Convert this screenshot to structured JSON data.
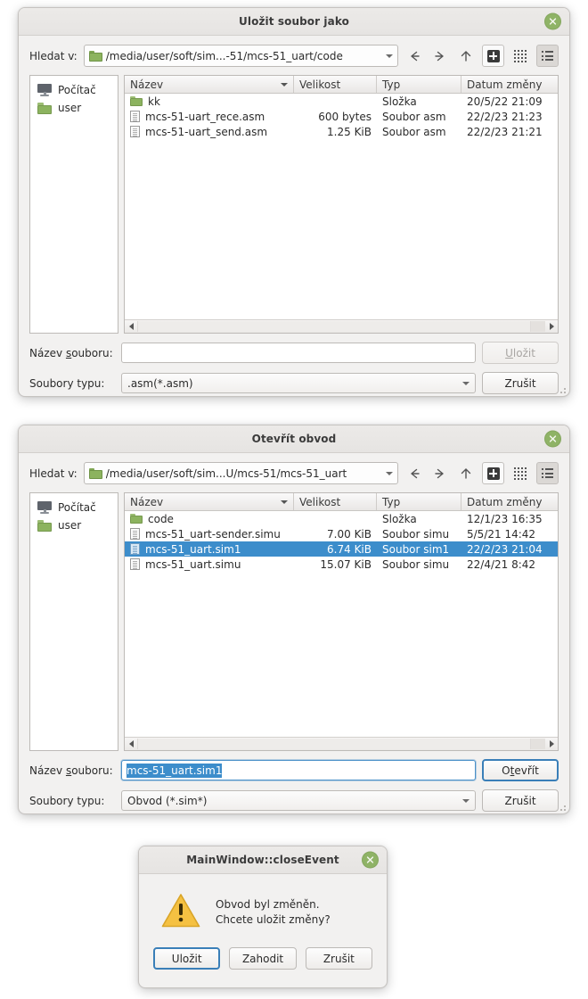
{
  "save_dialog": {
    "title": "Uložit soubor jako",
    "close_icon": "close-icon",
    "lookin_label": "Hledat v:",
    "path": "/media/user/soft/sim...-51/mcs-51_uart/code",
    "toolbar": {
      "back": "back-arrow-icon",
      "forward": "forward-arrow-icon",
      "up": "up-arrow-icon",
      "new_folder": "new-folder-icon",
      "grid_view": "grid-view-icon",
      "list_view": "list-view-icon"
    },
    "sidebar": [
      {
        "label": "Počítač",
        "icon": "computer-icon"
      },
      {
        "label": "user",
        "icon": "folder-icon"
      }
    ],
    "columns": [
      "Název",
      "Velikost",
      "Typ",
      "Datum změny"
    ],
    "files": [
      {
        "name": "kk",
        "size": "",
        "type": "Složka",
        "date": "20/5/22 21:09",
        "icon": "folder-icon",
        "selected": false
      },
      {
        "name": "mcs-51-uart_rece.asm",
        "size": "600 bytes",
        "type": "Soubor asm",
        "date": "22/2/23 21:23",
        "icon": "document-icon",
        "selected": false
      },
      {
        "name": "mcs-51-uart_send.asm",
        "size": "1.25 KiB",
        "type": "Soubor asm",
        "date": "22/2/23 21:21",
        "icon": "document-icon",
        "selected": false
      }
    ],
    "filename_label_pre": "Název ",
    "filename_label_key": "s",
    "filename_label_post": "ouboru:",
    "filename_value": "",
    "filetype_label": "Soubory typu:",
    "filetype_value": ".asm(*.asm)",
    "accept_button": "Uložit",
    "accept_key": "U",
    "cancel_button": "Zrušit"
  },
  "open_dialog": {
    "title": "Otevřít obvod",
    "close_icon": "close-icon",
    "lookin_label": "Hledat v:",
    "path": "/media/user/soft/sim...U/mcs-51/mcs-51_uart",
    "sidebar": [
      {
        "label": "Počítač",
        "icon": "computer-icon"
      },
      {
        "label": "user",
        "icon": "folder-icon"
      }
    ],
    "columns": [
      "Název",
      "Velikost",
      "Typ",
      "Datum změny"
    ],
    "files": [
      {
        "name": "code",
        "size": "",
        "type": "Složka",
        "date": "12/1/23 16:35",
        "icon": "folder-icon",
        "selected": false
      },
      {
        "name": "mcs-51_uart-sender.simu",
        "size": "7.00 KiB",
        "type": "Soubor simu",
        "date": "5/5/21 14:42",
        "icon": "document-icon",
        "selected": false
      },
      {
        "name": "mcs-51_uart.sim1",
        "size": "6.74 KiB",
        "type": "Soubor sim1",
        "date": "22/2/23 21:04",
        "icon": "document-icon",
        "selected": true
      },
      {
        "name": "mcs-51_uart.simu",
        "size": "15.07 KiB",
        "type": "Soubor simu",
        "date": "22/4/21 8:42",
        "icon": "document-icon",
        "selected": false
      }
    ],
    "filename_label_pre": "Název ",
    "filename_label_key": "s",
    "filename_label_post": "ouboru:",
    "filename_value": "mcs-51_uart.sim1",
    "filetype_label": "Soubory typu:",
    "filetype_value": "Obvod (*.sim*)",
    "accept_button_pre": "O",
    "accept_button_key": "t",
    "accept_button_post": "evřít",
    "cancel_button": "Zrušit"
  },
  "message_box": {
    "title": "MainWindow::closeEvent",
    "close_icon": "close-icon",
    "icon": "warning-triangle-icon",
    "text_line1": "Obvod byl změněn.",
    "text_line2": "Chcete uložit změny?",
    "buttons": [
      "Uložit",
      "Zahodit",
      "Zrušit"
    ]
  },
  "colors": {
    "selection_blue": "#3c8dcb",
    "close_green": "#8fb366",
    "folder_green": "#8cb35f",
    "warning_yellow": "#f5c142",
    "focus_blue": "#3a7fb8",
    "dialog_bg": "#f2f1f0"
  }
}
